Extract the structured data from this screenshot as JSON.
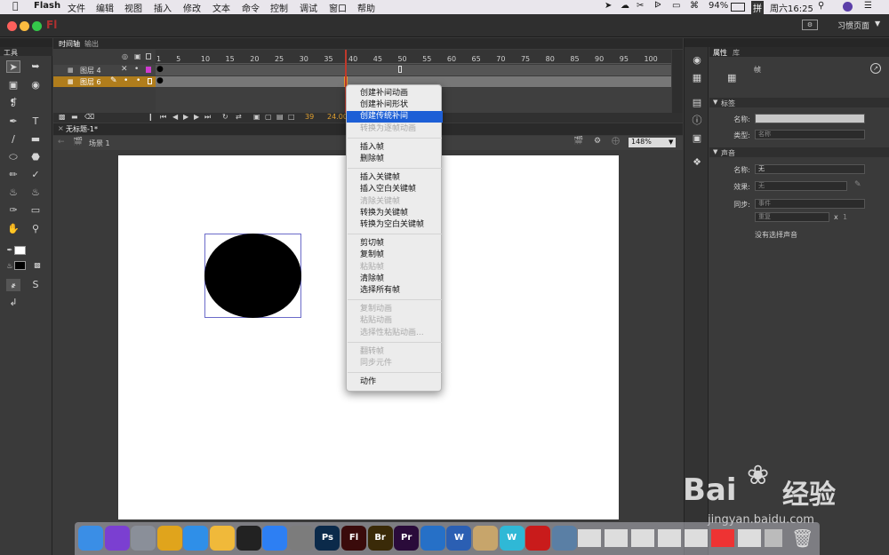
{
  "menubar": {
    "apple_icon": "apple-icon",
    "items": [
      "Flash",
      "文件",
      "编辑",
      "视图",
      "插入",
      "修改",
      "文本",
      "命令",
      "控制",
      "调试",
      "窗口",
      "帮助"
    ],
    "battery": "94%",
    "input_method": "拼",
    "clock": "周六16:25"
  },
  "window": {
    "app_badge": "Fl",
    "workspace": "习惯页面"
  },
  "timeline": {
    "tabs": [
      "时间轴",
      "输出"
    ],
    "layers": [
      {
        "name": "图层 4"
      },
      {
        "name": "图层 6"
      }
    ],
    "frame_numbers": [
      "1",
      "5",
      "10",
      "15",
      "20",
      "25",
      "30",
      "35",
      "40",
      "45",
      "50",
      "55",
      "60",
      "65",
      "70",
      "75",
      "80",
      "85",
      "90",
      "95",
      "100"
    ],
    "current_frame": "39",
    "fps": "24.00"
  },
  "tools_panel": {
    "title": "工具"
  },
  "document": {
    "tab": "无标题-1*",
    "scene": "场景 1",
    "zoom": "148%"
  },
  "context_menu": {
    "groups": [
      [
        {
          "label": "创建补间动画",
          "enabled": true
        },
        {
          "label": "创建补间形状",
          "enabled": true
        },
        {
          "label": "创建传统补间",
          "enabled": true,
          "highlighted": true
        },
        {
          "label": "转换为逐帧动画",
          "enabled": false
        }
      ],
      [
        {
          "label": "插入帧",
          "enabled": true
        },
        {
          "label": "删除帧",
          "enabled": true
        }
      ],
      [
        {
          "label": "插入关键帧",
          "enabled": true
        },
        {
          "label": "插入空白关键帧",
          "enabled": true
        },
        {
          "label": "清除关键帧",
          "enabled": false
        },
        {
          "label": "转换为关键帧",
          "enabled": true
        },
        {
          "label": "转换为空白关键帧",
          "enabled": true
        }
      ],
      [
        {
          "label": "剪切帧",
          "enabled": true
        },
        {
          "label": "复制帧",
          "enabled": true
        },
        {
          "label": "粘贴帧",
          "enabled": false
        },
        {
          "label": "清除帧",
          "enabled": true
        },
        {
          "label": "选择所有帧",
          "enabled": true
        }
      ],
      [
        {
          "label": "复制动画",
          "enabled": false
        },
        {
          "label": "粘贴动画",
          "enabled": false
        },
        {
          "label": "选择性粘贴动画...",
          "enabled": false
        }
      ],
      [
        {
          "label": "翻转帧",
          "enabled": false
        },
        {
          "label": "同步元件",
          "enabled": false
        }
      ],
      [
        {
          "label": "动作",
          "enabled": true
        }
      ]
    ]
  },
  "properties": {
    "tabs": [
      "属性",
      "库"
    ],
    "frame_label": "帧",
    "label_section": "标签",
    "name_label": "名称:",
    "type_label": "类型:",
    "type_value": "名称",
    "sound_section": "声音",
    "sound_name_label": "名称:",
    "sound_name_value": "无",
    "effect_label": "效果:",
    "effect_value": "无",
    "sync_label": "同步:",
    "sync_value": "事件",
    "repeat_value": "重复",
    "repeat_x": "x",
    "repeat_count": "1",
    "no_sound": "没有选择声音"
  },
  "dock": {
    "apps": [
      {
        "icon": "finder-icon",
        "label": "",
        "color": "#3a8ee6"
      },
      {
        "icon": "siri-icon",
        "label": "",
        "color": "#7b3fd1"
      },
      {
        "icon": "launchpad-icon",
        "label": "",
        "color": "#8a8f99"
      },
      {
        "icon": "chrome-icon",
        "label": "",
        "color": "#e0a41c"
      },
      {
        "icon": "safari-icon",
        "label": "",
        "color": "#2f8fe8"
      },
      {
        "icon": "photos-icon",
        "label": "",
        "color": "#f0b93a"
      },
      {
        "icon": "qq-icon",
        "label": "",
        "color": "#222222"
      },
      {
        "icon": "appstore-icon",
        "label": "",
        "color": "#2d7ff3"
      },
      {
        "icon": "system-preferences-icon",
        "label": "",
        "color": "#7c7c7c"
      },
      {
        "icon": "photoshop-icon",
        "label": "Ps",
        "color": "#0b2a4a"
      },
      {
        "icon": "flash-icon",
        "label": "Fl",
        "color": "#3a0b0b"
      },
      {
        "icon": "bridge-icon",
        "label": "Br",
        "color": "#3a2a08"
      },
      {
        "icon": "premiere-icon",
        "label": "Pr",
        "color": "#2a0b3a"
      },
      {
        "icon": "quicktime-icon",
        "label": "",
        "color": "#2670c7"
      },
      {
        "icon": "word-icon",
        "label": "W",
        "color": "#2b5fb3"
      },
      {
        "icon": "preview-icon",
        "label": "",
        "color": "#c7a56b"
      },
      {
        "icon": "wps-icon",
        "label": "W",
        "color": "#2fb8d6"
      },
      {
        "icon": "flash-player-icon",
        "label": "",
        "color": "#c91b1b"
      },
      {
        "icon": "image-capture-icon",
        "label": "",
        "color": "#5a7fa5"
      }
    ]
  },
  "watermark": {
    "brand": "Bai",
    "brand2": "经验",
    "url": "jingyan.baidu.com"
  }
}
